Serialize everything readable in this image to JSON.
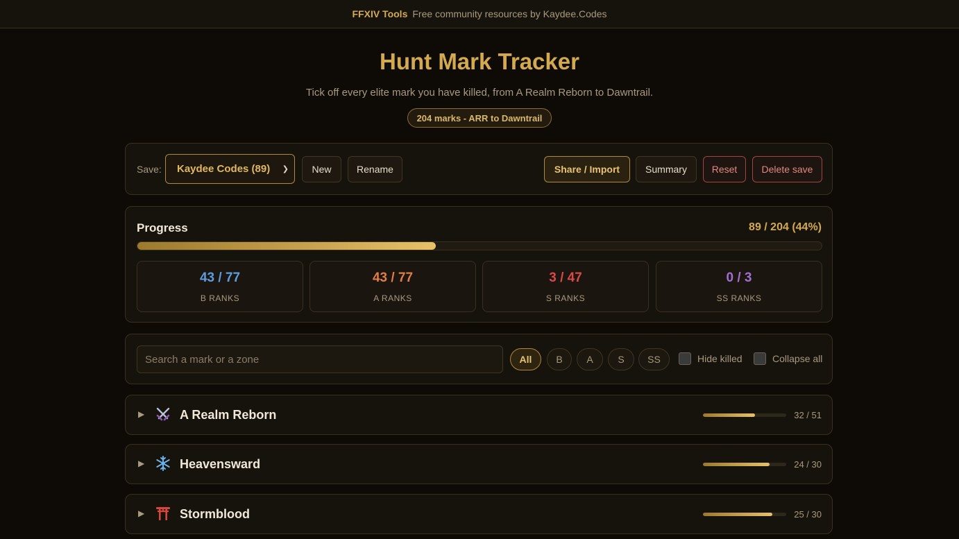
{
  "topbar": {
    "brand": "FFXIV Tools",
    "tagline": "Free community resources by Kaydee.Codes"
  },
  "header": {
    "title": "Hunt Mark Tracker",
    "subtitle": "Tick off every elite mark you have killed, from A Realm Reborn to Dawntrail.",
    "badge": "204 marks - ARR to Dawntrail"
  },
  "savebar": {
    "label": "Save:",
    "selected": "Kaydee Codes (89)",
    "buttons": {
      "new": "New",
      "rename": "Rename",
      "share": "Share / Import",
      "summary": "Summary",
      "reset": "Reset",
      "delete": "Delete save"
    }
  },
  "progress": {
    "label": "Progress",
    "value_text": "89 / 204 (44%)",
    "fraction": 0.436,
    "stats": [
      {
        "value": "43 / 77",
        "label": "B RANKS",
        "color": "#5b9ee0"
      },
      {
        "value": "43 / 77",
        "label": "A RANKS",
        "color": "#e07f45"
      },
      {
        "value": "3 / 47",
        "label": "S RANKS",
        "color": "#d84a48"
      },
      {
        "value": "0 / 3",
        "label": "SS RANKS",
        "color": "#a070d0"
      }
    ]
  },
  "filters": {
    "search_placeholder": "Search a mark or a zone",
    "chips": [
      "All",
      "B",
      "A",
      "S",
      "SS"
    ],
    "active_chip": "All",
    "hide_killed": "Hide killed",
    "collapse_all": "Collapse all"
  },
  "expansions": [
    {
      "name": "A Realm Reborn",
      "count": "32 / 51",
      "fraction": 0.627,
      "icon": "crossed-swords-icon"
    },
    {
      "name": "Heavensward",
      "count": "24 / 30",
      "fraction": 0.8,
      "icon": "snowflake-icon"
    },
    {
      "name": "Stormblood",
      "count": "25 / 30",
      "fraction": 0.833,
      "icon": "torii-gate-icon"
    }
  ],
  "colors": {
    "accent": "#d4aa50",
    "background": "#0e0b07",
    "danger": "#a24545"
  }
}
